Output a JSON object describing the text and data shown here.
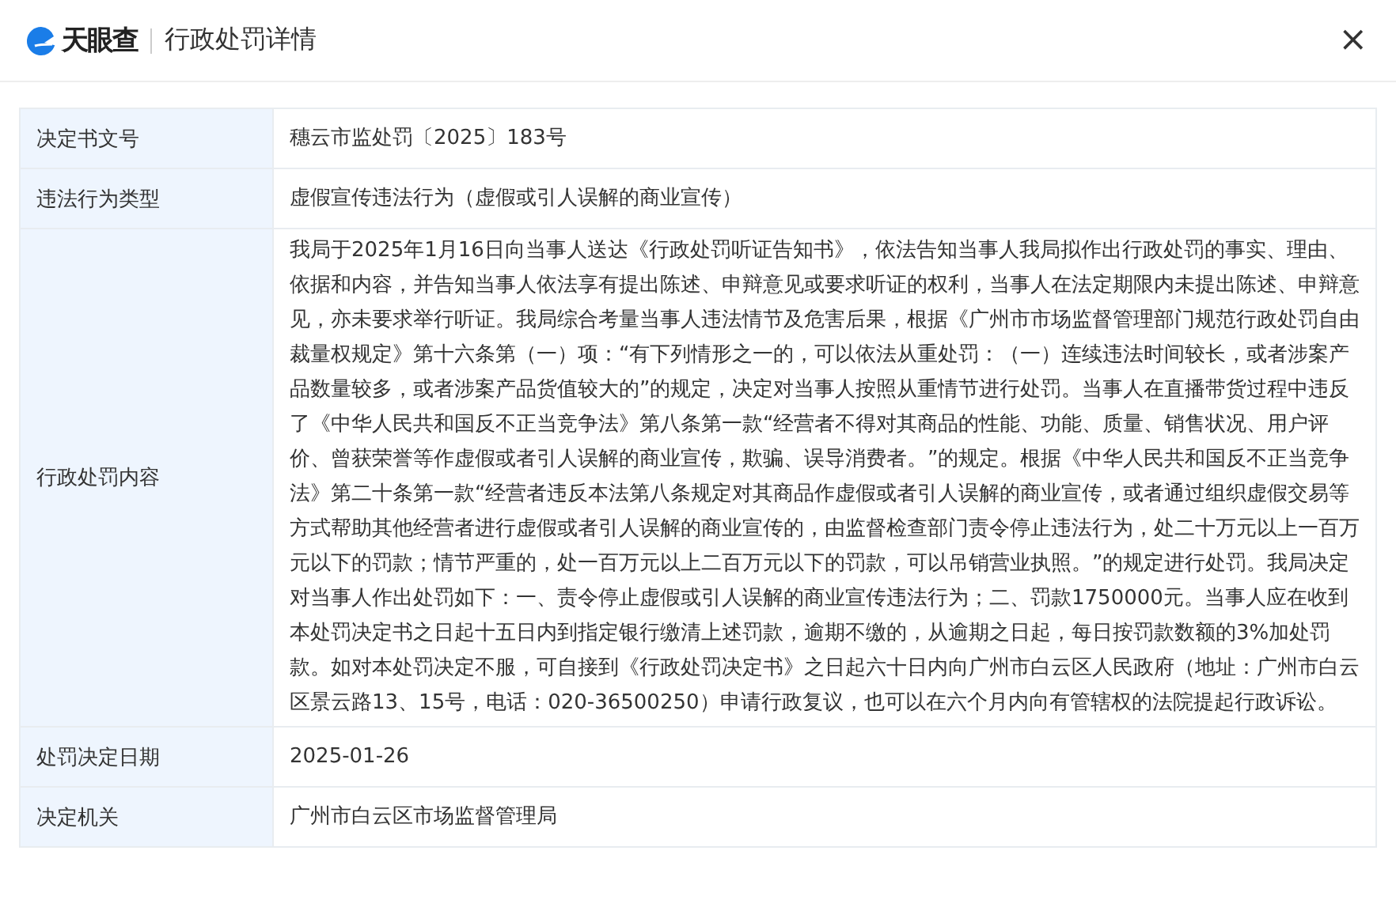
{
  "header": {
    "logo_text": "天眼查",
    "title": "行政处罚详情",
    "close": "×"
  },
  "table": {
    "rows": [
      {
        "label": "决定书文号",
        "value": "穗云市监处罚〔2025〕183号"
      },
      {
        "label": "违法行为类型",
        "value": "虚假宣传违法行为（虚假或引人误解的商业宣传）"
      },
      {
        "label": "行政处罚内容",
        "value": "我局于2025年1月16日向当事人送达《行政处罚听证告知书》，依法告知当事人我局拟作出行政处罚的事实、理由、依据和内容，并告知当事人依法享有提出陈述、申辩意见或要求听证的权利，当事人在法定期限内未提出陈述、申辩意见，亦未要求举行听证。我局综合考量当事人违法情节及危害后果，根据《广州市市场监督管理部门规范行政处罚自由裁量权规定》第十六条第（一）项：“有下列情形之一的，可以依法从重处罚：（一）连续违法时间较长，或者涉案产品数量较多，或者涉案产品货值较大的”的规定，决定对当事人按照从重情节进行处罚。当事人在直播带货过程中违反了《中华人民共和国反不正当竞争法》第八条第一款“经营者不得对其商品的性能、功能、质量、销售状况、用户评价、曾获荣誉等作虚假或者引人误解的商业宣传，欺骗、误导消费者。”的规定。根据《中华人民共和国反不正当竞争法》第二十条第一款“经营者违反本法第八条规定对其商品作虚假或者引人误解的商业宣传，或者通过组织虚假交易等方式帮助其他经营者进行虚假或者引人误解的商业宣传的，由监督检查部门责令停止违法行为，处二十万元以上一百万元以下的罚款；情节严重的，处一百万元以上二百万元以下的罚款，可以吊销营业执照。”的规定进行处罚。我局决定对当事人作出处罚如下：一、责令停止虚假或引人误解的商业宣传违法行为；二、罚款1750000元。当事人应在收到本处罚决定书之日起十五日内到指定银行缴清上述罚款，逾期不缴的，从逾期之日起，每日按罚款数额的3%加处罚款。如对本处罚决定不服，可自接到《行政处罚决定书》之日起六十日内向广州市白云区人民政府（地址：广州市白云区景云路13、15号，电话：020-36500250）申请行政复议，也可以在六个月内向有管辖权的法院提起行政诉讼。"
      },
      {
        "label": "处罚决定日期",
        "value": "2025-01-26"
      },
      {
        "label": "决定机关",
        "value": "广州市白云区市场监督管理局"
      }
    ]
  }
}
